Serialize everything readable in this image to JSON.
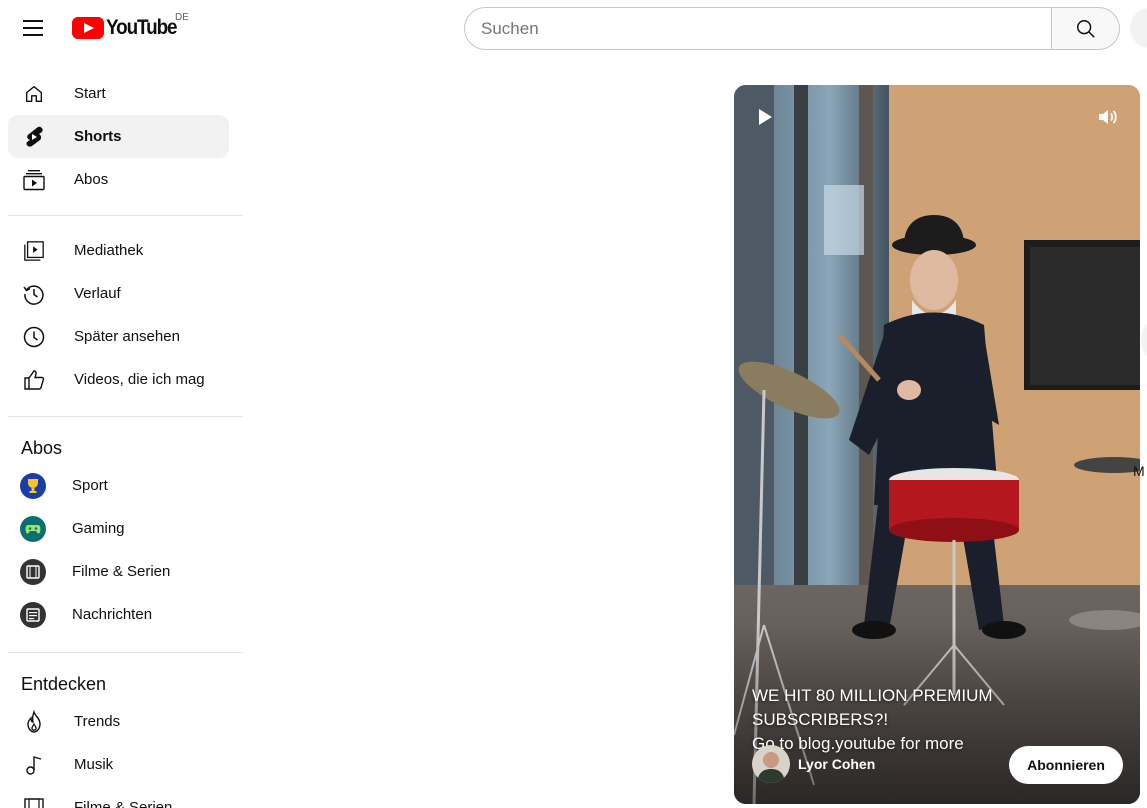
{
  "header": {
    "logo_text": "YouTube",
    "country_code": "DE",
    "search_placeholder": "Suchen"
  },
  "sidebar": {
    "main": [
      {
        "label": "Start",
        "icon": "home-icon"
      },
      {
        "label": "Shorts",
        "icon": "shorts-icon",
        "active": true
      },
      {
        "label": "Abos",
        "icon": "subscriptions-icon"
      }
    ],
    "library": [
      {
        "label": "Mediathek",
        "icon": "library-icon"
      },
      {
        "label": "Verlauf",
        "icon": "history-icon"
      },
      {
        "label": "Später ansehen",
        "icon": "watch-later-icon"
      },
      {
        "label": "Videos, die ich mag",
        "icon": "thumbs-up-icon"
      }
    ],
    "subscriptions_title": "Abos",
    "subscriptions": [
      {
        "label": "Sport",
        "icon": "sport-channel-icon"
      },
      {
        "label": "Gaming",
        "icon": "gaming-channel-icon"
      },
      {
        "label": "Filme & Serien",
        "icon": "movies-channel-icon"
      },
      {
        "label": "Nachrichten",
        "icon": "news-channel-icon"
      }
    ],
    "explore_title": "Entdecken",
    "explore": [
      {
        "label": "Trends",
        "icon": "trending-icon"
      },
      {
        "label": "Musik",
        "icon": "music-icon"
      },
      {
        "label": "Filme & Serien",
        "icon": "film-icon"
      }
    ]
  },
  "short": {
    "caption_line1": "WE HIT 80 MILLION PREMIUM SUBSCRIBERS?!",
    "caption_line2": "Go to blog.youtube for more",
    "channel_name": "Lyor Cohen",
    "subscribe_label": "Abonnieren"
  },
  "edge_text": "M"
}
